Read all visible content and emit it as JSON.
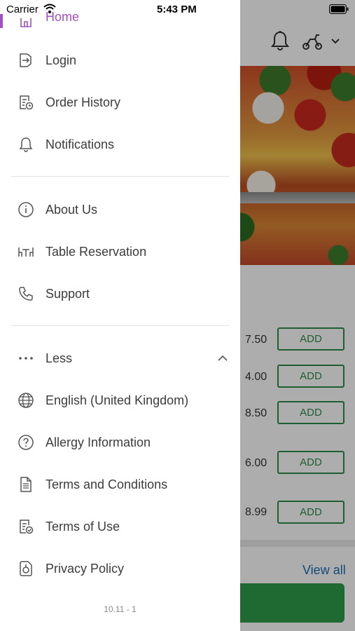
{
  "status_bar": {
    "carrier": "Carrier",
    "time": "5:43 PM"
  },
  "menu": {
    "home": "Home",
    "login": "Login",
    "order_history": "Order History",
    "notifications": "Notifications",
    "about_us": "About Us",
    "table_reservation": "Table Reservation",
    "support": "Support",
    "less": "Less",
    "language": "English (United Kingdom)",
    "allergy": "Allergy Information",
    "terms_conditions": "Terms and Conditions",
    "terms_use": "Terms of Use",
    "privacy": "Privacy Policy"
  },
  "version": "10.11 - 1",
  "background": {
    "prices": [
      "7.50",
      "4.00",
      "8.50",
      "6.00",
      "8.99"
    ],
    "add_label": "ADD",
    "view_all": "View all"
  },
  "colors": {
    "accent": "#a24fc0",
    "green": "#2f8a4b",
    "link": "#1d6fb3"
  }
}
